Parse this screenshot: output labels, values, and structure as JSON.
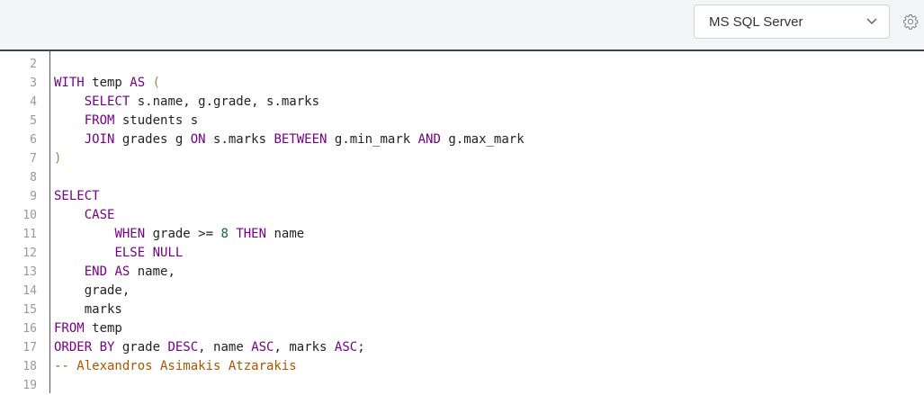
{
  "toolbar": {
    "dialect": "MS SQL Server",
    "settings_icon": "gear-icon"
  },
  "colors": {
    "keyword": "#770088",
    "number": "#116644",
    "comment": "#aa5500",
    "paren": "#a08050"
  },
  "lines": [
    {
      "n": "2",
      "tokens": []
    },
    {
      "n": "3",
      "tokens": [
        [
          "WITH",
          "kw"
        ],
        [
          " temp ",
          ""
        ],
        [
          "AS",
          "kw"
        ],
        [
          " ",
          ""
        ],
        [
          "(",
          "pn"
        ]
      ]
    },
    {
      "n": "4",
      "tokens": [
        [
          "    ",
          ""
        ],
        [
          "SELECT",
          "kw"
        ],
        [
          " s.name, g.grade, s.marks",
          ""
        ]
      ]
    },
    {
      "n": "5",
      "tokens": [
        [
          "    ",
          ""
        ],
        [
          "FROM",
          "kw"
        ],
        [
          " students s",
          ""
        ]
      ]
    },
    {
      "n": "6",
      "tokens": [
        [
          "    ",
          ""
        ],
        [
          "JOIN",
          "kw"
        ],
        [
          " grades g ",
          ""
        ],
        [
          "ON",
          "kw"
        ],
        [
          " s.marks ",
          ""
        ],
        [
          "BETWEEN",
          "kw"
        ],
        [
          " g.min_mark ",
          ""
        ],
        [
          "AND",
          "kw"
        ],
        [
          " g.max_mark",
          ""
        ]
      ]
    },
    {
      "n": "7",
      "tokens": [
        [
          ")",
          "pn"
        ]
      ]
    },
    {
      "n": "8",
      "tokens": []
    },
    {
      "n": "9",
      "tokens": [
        [
          "SELECT",
          "kw"
        ]
      ]
    },
    {
      "n": "10",
      "tokens": [
        [
          "    ",
          ""
        ],
        [
          "CASE",
          "kw"
        ]
      ]
    },
    {
      "n": "11",
      "tokens": [
        [
          "        ",
          ""
        ],
        [
          "WHEN",
          "kw"
        ],
        [
          " grade >= ",
          ""
        ],
        [
          "8",
          "num"
        ],
        [
          " ",
          ""
        ],
        [
          "THEN",
          "kw"
        ],
        [
          " name",
          ""
        ]
      ]
    },
    {
      "n": "12",
      "tokens": [
        [
          "        ",
          ""
        ],
        [
          "ELSE",
          "kw"
        ],
        [
          " ",
          ""
        ],
        [
          "NULL",
          "kw"
        ]
      ]
    },
    {
      "n": "13",
      "tokens": [
        [
          "    ",
          ""
        ],
        [
          "END",
          "kw"
        ],
        [
          " ",
          ""
        ],
        [
          "AS",
          "kw"
        ],
        [
          " name,",
          ""
        ]
      ]
    },
    {
      "n": "14",
      "tokens": [
        [
          "    grade,",
          ""
        ]
      ]
    },
    {
      "n": "15",
      "tokens": [
        [
          "    marks",
          ""
        ]
      ]
    },
    {
      "n": "16",
      "tokens": [
        [
          "FROM",
          "kw"
        ],
        [
          " temp",
          ""
        ]
      ]
    },
    {
      "n": "17",
      "tokens": [
        [
          "ORDER BY",
          "kw"
        ],
        [
          " grade ",
          ""
        ],
        [
          "DESC",
          "kw"
        ],
        [
          ", name ",
          ""
        ],
        [
          "ASC",
          "kw"
        ],
        [
          ", marks ",
          ""
        ],
        [
          "ASC",
          "kw"
        ],
        [
          ";",
          ""
        ]
      ]
    },
    {
      "n": "18",
      "tokens": [
        [
          "-- Alexandros Asimakis Atzarakis",
          "cm"
        ]
      ]
    },
    {
      "n": "19",
      "tokens": []
    }
  ]
}
